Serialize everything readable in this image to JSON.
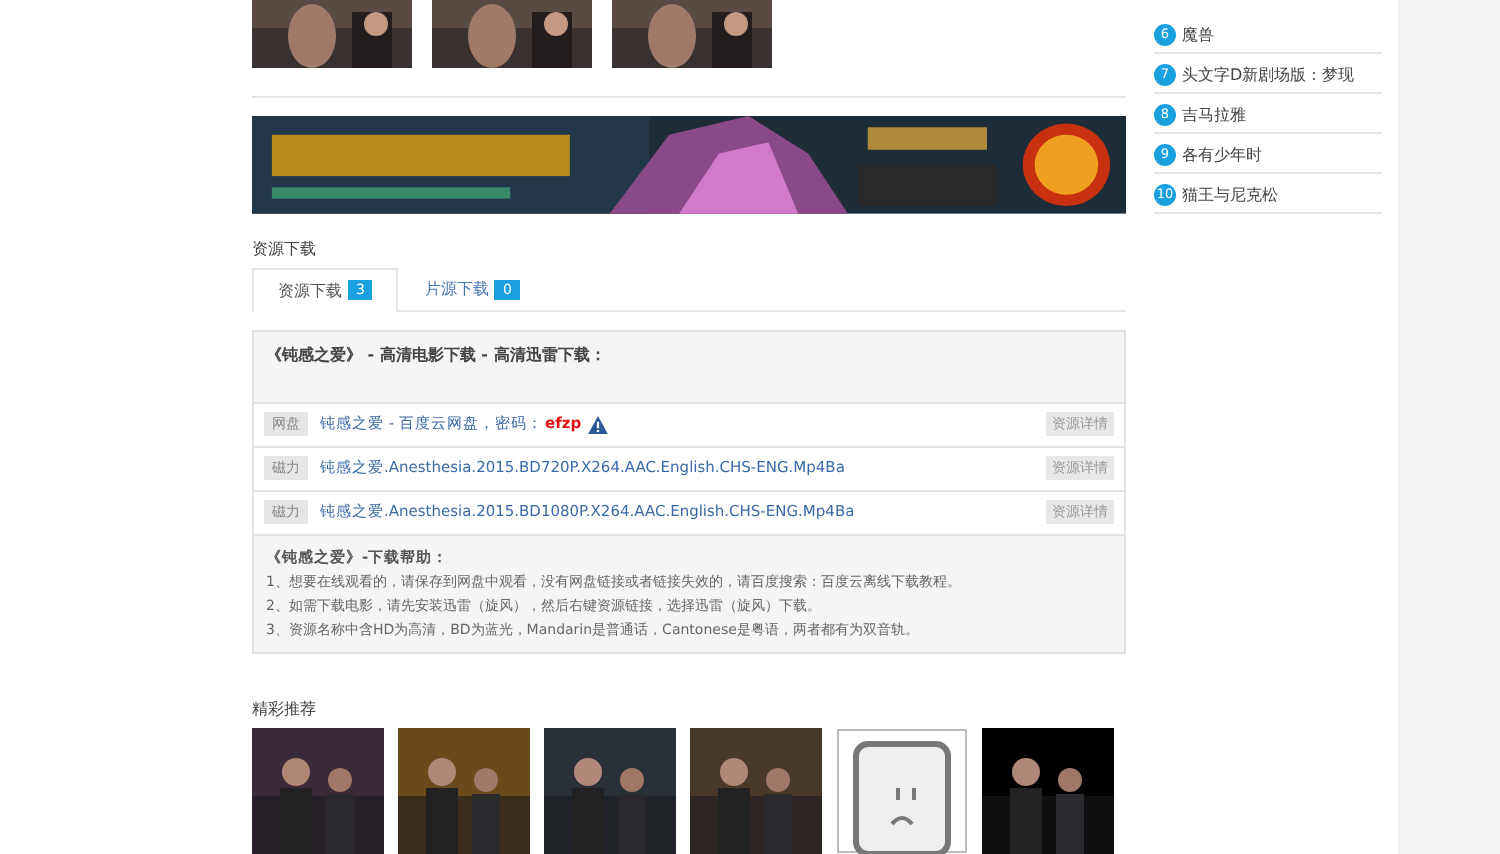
{
  "top_thumbnails": [
    {
      "kind": "picture"
    },
    {
      "kind": "picture"
    },
    {
      "kind": "picture"
    }
  ],
  "banner": {
    "kind": "picture"
  },
  "resources": {
    "heading": "资源下载",
    "tabs": [
      {
        "label": "资源下载",
        "count": "3",
        "selected": true
      },
      {
        "label": "片源下载",
        "count": "0",
        "selected": false
      }
    ],
    "title": "《钝感之爱》 - 高清电影下载 - 高清迅雷下载：",
    "links": [
      {
        "type": "网盘",
        "text": "钝感之爱 - 百度云网盘，密码：",
        "code": "efzp",
        "action": "资源详情"
      },
      {
        "type": "磁力",
        "text": "钝感之爱.Anesthesia.2015.BD720P.X264.AAC.English.CHS-ENG.Mp4Ba",
        "action": "资源详情"
      },
      {
        "type": "磁力",
        "text": "钝感之爱.Anesthesia.2015.BD1080P.X264.AAC.English.CHS-ENG.Mp4Ba",
        "action": "资源详情"
      }
    ],
    "help_title": "《钝感之爱》-下载帮助：",
    "help": [
      "1、想要在线观看的，请保存到网盘中观看，没有网盘链接或者链接失效的，请百度搜索：百度云离线下载教程。",
      "2、如需下载电影，请先安装迅雷（旋风），然后右键资源链接，选择迅雷（旋风）下载。",
      "3、资源名称中含HD为高清，BD为蓝光，Mandarin是普通话，Cantonese是粤语，两者都有为双音轨。"
    ]
  },
  "recommend": {
    "heading": "精彩推荐",
    "posters": [
      {
        "kind": "picture"
      },
      {
        "kind": "picture"
      },
      {
        "kind": "picture"
      },
      {
        "kind": "picture"
      },
      {
        "kind": "placeholder"
      },
      {
        "kind": "picture"
      }
    ]
  },
  "ranking": [
    {
      "rank": "6",
      "title": "魔兽"
    },
    {
      "rank": "7",
      "title": "头文字D新剧场版：梦现"
    },
    {
      "rank": "8",
      "title": "吉马拉雅"
    },
    {
      "rank": "9",
      "title": "各有少年时"
    },
    {
      "rank": "10",
      "title": "猫王与尼克松"
    }
  ]
}
